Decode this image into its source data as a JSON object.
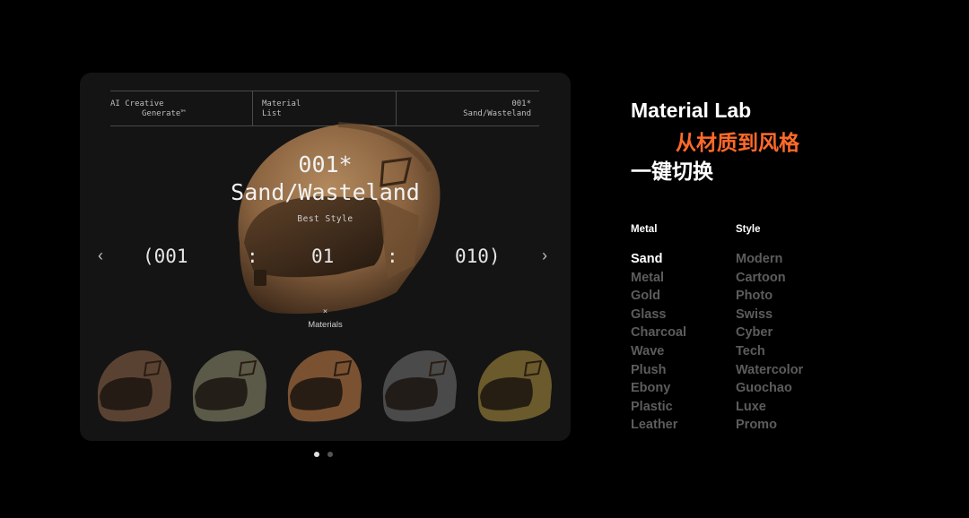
{
  "card": {
    "header": {
      "left_line1": "AI Creative",
      "left_line2": "Generate™",
      "mid_line1": "Material",
      "mid_line2": "List",
      "right_line1": "001*",
      "right_line2": "Sand/Wasteland"
    },
    "title_number": "001*",
    "title_name": "Sand/Wasteland",
    "subtitle": "Best Style",
    "counter": {
      "open": "(001",
      "sep1": ":",
      "middle": "01",
      "sep2": ":",
      "close": "010)"
    },
    "prev_icon": "chevron-left-icon",
    "next_icon": "chevron-right-icon",
    "x_mark": "×",
    "materials_label": "Materials",
    "thumbnails": [
      {
        "name": "helmet-brown",
        "color": "#5a4232"
      },
      {
        "name": "helmet-olive",
        "color": "#5b5a48"
      },
      {
        "name": "helmet-tan",
        "color": "#7a5232"
      },
      {
        "name": "helmet-grey",
        "color": "#4a4a4a"
      },
      {
        "name": "helmet-camo",
        "color": "#6a5a2c"
      }
    ]
  },
  "pagination": {
    "total": 2,
    "active": 1
  },
  "info": {
    "title_line1": "Material Lab",
    "title_line2": "从材质到风格",
    "title_line3": "一键切换",
    "accent_color": "#ff6a2a",
    "metal_header": "Metal",
    "style_header": "Style",
    "metal_items": [
      "Sand",
      "Metal",
      "Gold",
      "Glass",
      "Charcoal",
      "Wave",
      "Plush",
      "Ebony",
      "Plastic",
      "Leather"
    ],
    "style_items": [
      "Modern",
      "Cartoon",
      "Photo",
      "Swiss",
      "Cyber",
      "Tech",
      "Watercolor",
      "Guochao",
      "Luxe",
      "Promo"
    ],
    "active_metal": "Sand"
  }
}
